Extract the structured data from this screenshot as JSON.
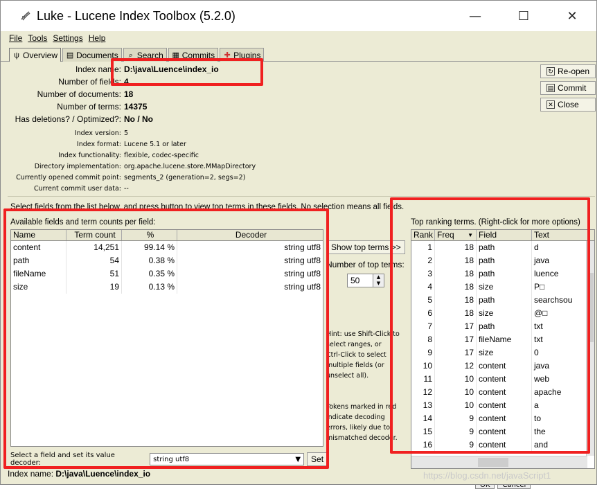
{
  "window": {
    "title": "Luke - Lucene Index Toolbox (5.2.0)",
    "minimize": "—",
    "maximize": "☐",
    "close": "✕"
  },
  "menu": [
    "File",
    "Tools",
    "Settings",
    "Help"
  ],
  "tabs": [
    {
      "label": "Overview",
      "icon": "ψ",
      "active": true
    },
    {
      "label": "Documents",
      "icon": "▤"
    },
    {
      "label": "Search",
      "icon": "⌕"
    },
    {
      "label": "Commits",
      "icon": "▦"
    },
    {
      "label": "Plugins",
      "icon": "✚"
    }
  ],
  "overview": {
    "index_name_label": "Index name:",
    "index_name": "D:\\java\\Luence\\index_io",
    "fields_label": "Number of fields:",
    "fields": "4",
    "docs_label": "Number of documents:",
    "docs": "18",
    "terms_label": "Number of terms:",
    "terms": "14375",
    "deletions_label": "Has deletions? / Optimized?:",
    "deletions": "No / No",
    "version_label": "Index version:",
    "version": "5",
    "format_label": "Index format:",
    "format": "Lucene 5.1 or later",
    "functionality_label": "Index functionality:",
    "functionality": "flexible, codec-specific",
    "directory_label": "Directory implementation:",
    "directory": "org.apache.lucene.store.MMapDirectory",
    "commit_label": "Currently opened commit point:",
    "commit": "segments_2 (generation=2, segs=2)",
    "user_data_label": "Current commit user data:",
    "user_data": "--"
  },
  "side_buttons": {
    "reopen": "Re-open",
    "commit": "Commit",
    "close": "Close"
  },
  "select_hint": "Select fields from the list below, and press button to view top terms in these fields. No selection means all fields.",
  "fields_panel": {
    "title": "Available fields and term counts per field:",
    "headers": [
      "Name",
      "Term count",
      "%",
      "Decoder"
    ],
    "rows": [
      [
        "content",
        "14,251",
        "99.14 %",
        "string utf8"
      ],
      [
        "path",
        "54",
        "0.38 %",
        "string utf8"
      ],
      [
        "fileName",
        "51",
        "0.35 %",
        "string utf8"
      ],
      [
        "size",
        "19",
        "0.13 %",
        "string utf8"
      ]
    ],
    "decoder_label": "Select a field and set its value decoder:",
    "decoder_value": "string utf8",
    "set_button": "Set"
  },
  "middle": {
    "show_button": "Show top terms >>",
    "num_label": "Number of top terms:",
    "num_value": "50",
    "hint1": "Hint: use Shift-Click to\nselect ranges, or\nCtrl-Click to select\nmultiple fields (or\nunselect all).",
    "hint2": "Tokens marked in red\nindicate decoding\nerrors, likely due to\nmismatched decoder."
  },
  "terms_panel": {
    "title": "Top ranking terms. (Right-click for more options)",
    "headers": [
      "Rank",
      "Freq",
      "Field",
      "Text"
    ],
    "rows": [
      [
        "1",
        "18",
        "path",
        "d"
      ],
      [
        "2",
        "18",
        "path",
        "java"
      ],
      [
        "3",
        "18",
        "path",
        "luence"
      ],
      [
        "4",
        "18",
        "size",
        "P□"
      ],
      [
        "5",
        "18",
        "path",
        "searchsou"
      ],
      [
        "6",
        "18",
        "size",
        "@□"
      ],
      [
        "7",
        "17",
        "path",
        "txt"
      ],
      [
        "8",
        "17",
        "fileName",
        "txt"
      ],
      [
        "9",
        "17",
        "size",
        "0"
      ],
      [
        "10",
        "12",
        "content",
        "java"
      ],
      [
        "11",
        "10",
        "content",
        "web"
      ],
      [
        "12",
        "10",
        "content",
        "apache"
      ],
      [
        "13",
        "10",
        "content",
        "a"
      ],
      [
        "14",
        "9",
        "content",
        "to"
      ],
      [
        "15",
        "9",
        "content",
        "the"
      ],
      [
        "16",
        "9",
        "content",
        "and"
      ]
    ]
  },
  "status": {
    "label": "Index name:",
    "value": "D:\\java\\Luence\\index_io"
  },
  "watermark": "https://blog.csdn.net/javaScript1",
  "background_buttons": [
    "OK",
    "Cancel"
  ],
  "colors": {
    "annotation": "#f02020",
    "window_bg": "#ecebd5"
  }
}
